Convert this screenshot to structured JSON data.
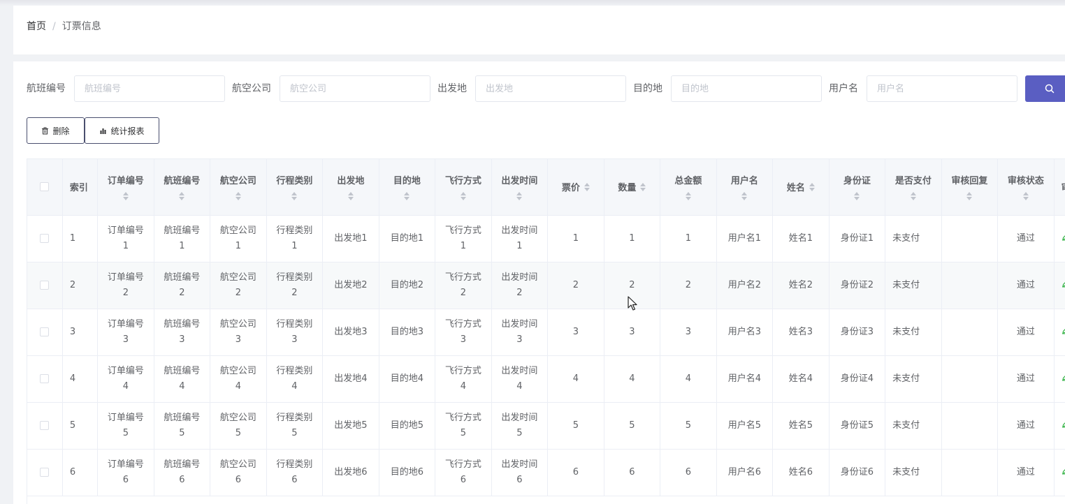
{
  "breadcrumb": {
    "home": "首页",
    "separator": "/",
    "current": "订票信息"
  },
  "filters": [
    {
      "label": "航班编号",
      "placeholder": "航班编号",
      "value": ""
    },
    {
      "label": "航空公司",
      "placeholder": "航空公司",
      "value": ""
    },
    {
      "label": "出发地",
      "placeholder": "出发地",
      "value": ""
    },
    {
      "label": "目的地",
      "placeholder": "目的地",
      "value": ""
    },
    {
      "label": "用户名",
      "placeholder": "用户名",
      "value": ""
    }
  ],
  "actions": {
    "delete_label": "删除",
    "report_label": "统计报表"
  },
  "colors": {
    "primary": "#5a5ec2",
    "edit": "#39b54a",
    "header_bg": "#f5f7fa",
    "border": "#ebeef5"
  },
  "table": {
    "headers": [
      "索引",
      "订单编号",
      "航班编号",
      "航空公司",
      "行程类别",
      "出发地",
      "目的地",
      "飞行方式",
      "出发时间",
      "票价",
      "数量",
      "总金额",
      "用户名",
      "姓名",
      "身份证",
      "是否支付",
      "审核回复",
      "审核状态",
      "审核"
    ],
    "rows": [
      {
        "index": "1",
        "order": [
          "订单编号",
          "1"
        ],
        "flight": [
          "航班编号",
          "1"
        ],
        "airline": [
          "航空公司",
          "1"
        ],
        "trip": [
          "行程类别",
          "1"
        ],
        "from": "出发地1",
        "to": "目的地1",
        "mode": [
          "飞行方式",
          "1"
        ],
        "time": [
          "出发时间",
          "1"
        ],
        "price": "1",
        "qty": "1",
        "total": "1",
        "user": "用户名1",
        "name": "姓名1",
        "id": "身份证1",
        "paid": "未支付",
        "reply": "",
        "status": "通过"
      },
      {
        "index": "2",
        "order": [
          "订单编号",
          "2"
        ],
        "flight": [
          "航班编号",
          "2"
        ],
        "airline": [
          "航空公司",
          "2"
        ],
        "trip": [
          "行程类别",
          "2"
        ],
        "from": "出发地2",
        "to": "目的地2",
        "mode": [
          "飞行方式",
          "2"
        ],
        "time": [
          "出发时间",
          "2"
        ],
        "price": "2",
        "qty": "2",
        "total": "2",
        "user": "用户名2",
        "name": "姓名2",
        "id": "身份证2",
        "paid": "未支付",
        "reply": "",
        "status": "通过"
      },
      {
        "index": "3",
        "order": [
          "订单编号",
          "3"
        ],
        "flight": [
          "航班编号",
          "3"
        ],
        "airline": [
          "航空公司",
          "3"
        ],
        "trip": [
          "行程类别",
          "3"
        ],
        "from": "出发地3",
        "to": "目的地3",
        "mode": [
          "飞行方式",
          "3"
        ],
        "time": [
          "出发时间",
          "3"
        ],
        "price": "3",
        "qty": "3",
        "total": "3",
        "user": "用户名3",
        "name": "姓名3",
        "id": "身份证3",
        "paid": "未支付",
        "reply": "",
        "status": "通过"
      },
      {
        "index": "4",
        "order": [
          "订单编号",
          "4"
        ],
        "flight": [
          "航班编号",
          "4"
        ],
        "airline": [
          "航空公司",
          "4"
        ],
        "trip": [
          "行程类别",
          "4"
        ],
        "from": "出发地4",
        "to": "目的地4",
        "mode": [
          "飞行方式",
          "4"
        ],
        "time": [
          "出发时间",
          "4"
        ],
        "price": "4",
        "qty": "4",
        "total": "4",
        "user": "用户名4",
        "name": "姓名4",
        "id": "身份证4",
        "paid": "未支付",
        "reply": "",
        "status": "通过"
      },
      {
        "index": "5",
        "order": [
          "订单编号",
          "5"
        ],
        "flight": [
          "航班编号",
          "5"
        ],
        "airline": [
          "航空公司",
          "5"
        ],
        "trip": [
          "行程类别",
          "5"
        ],
        "from": "出发地5",
        "to": "目的地5",
        "mode": [
          "飞行方式",
          "5"
        ],
        "time": [
          "出发时间",
          "5"
        ],
        "price": "5",
        "qty": "5",
        "total": "5",
        "user": "用户名5",
        "name": "姓名5",
        "id": "身份证5",
        "paid": "未支付",
        "reply": "",
        "status": "通过"
      },
      {
        "index": "6",
        "order": [
          "订单编号",
          "6"
        ],
        "flight": [
          "航班编号",
          "6"
        ],
        "airline": [
          "航空公司",
          "6"
        ],
        "trip": [
          "行程类别",
          "6"
        ],
        "from": "出发地6",
        "to": "目的地6",
        "mode": [
          "飞行方式",
          "6"
        ],
        "time": [
          "出发时间",
          "6"
        ],
        "price": "6",
        "qty": "6",
        "total": "6",
        "user": "用户名6",
        "name": "姓名6",
        "id": "身份证6",
        "paid": "未支付",
        "reply": "",
        "status": "通过"
      }
    ]
  }
}
